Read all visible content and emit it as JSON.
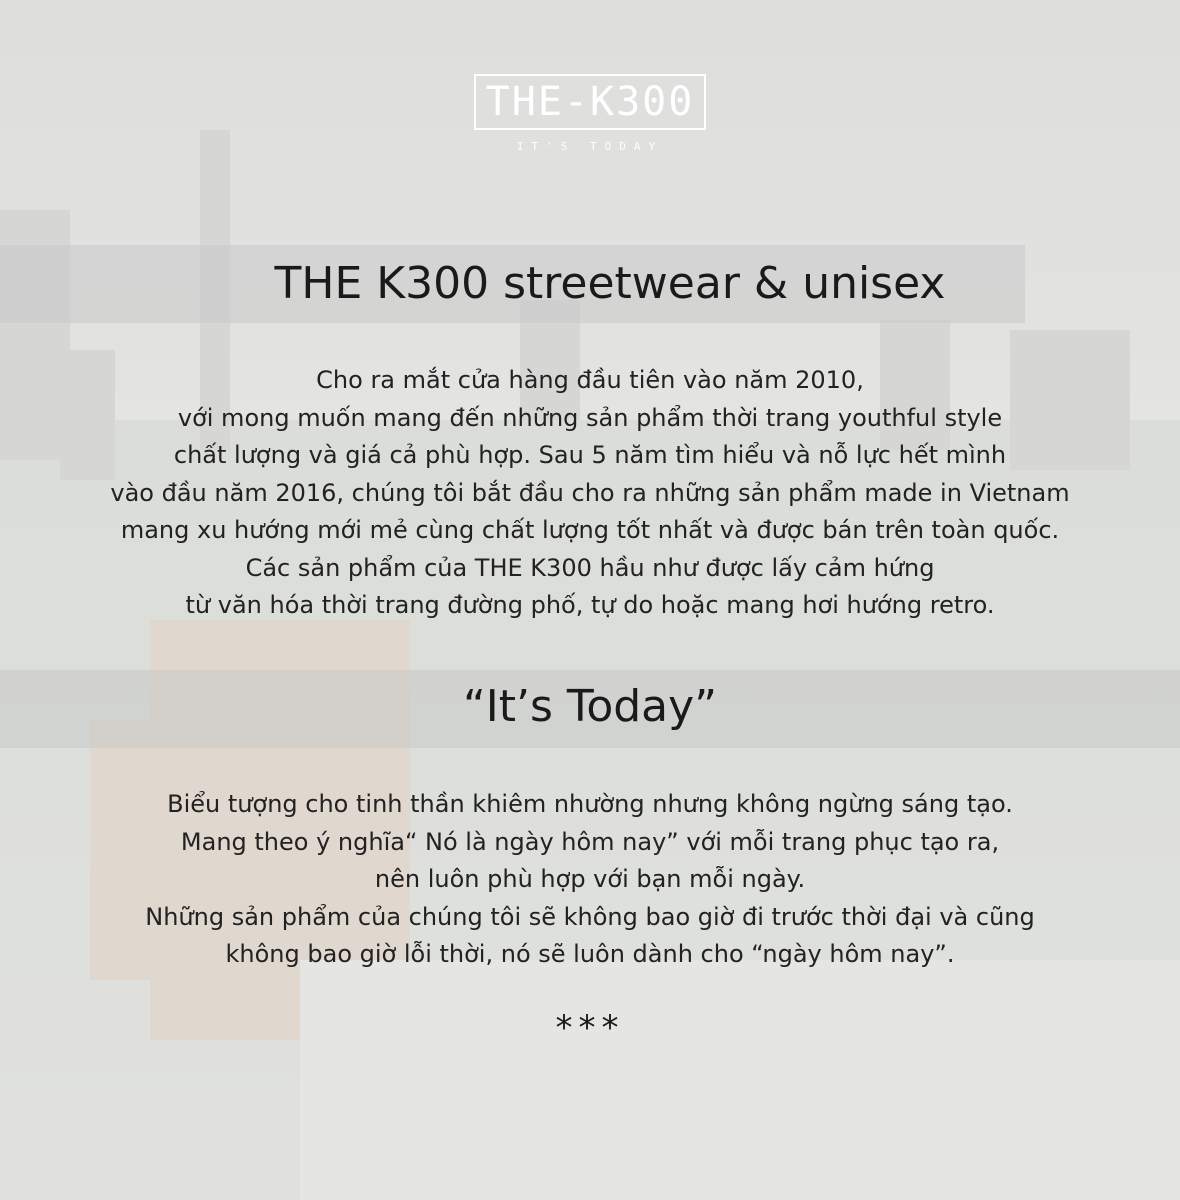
{
  "logo": {
    "wordmark": "THE-K300",
    "tagline": "IT'S TODAY"
  },
  "heading": "THE K300 streetwear & unisex",
  "intro_lines": [
    "Cho ra mắt cửa hàng đầu tiên vào năm 2010,",
    "với mong muốn mang đến những sản phẩm thời trang youthful style",
    "chất lượng và giá cả phù hợp. Sau 5 năm tìm hiểu và nỗ lực hết mình",
    "vào đầu năm 2016, chúng tôi bắt đầu cho ra những sản phẩm made in Vietnam",
    "mang xu hướng mới mẻ cùng chất lượng tốt nhất và được bán trên toàn quốc.",
    "Các sản phẩm của THE K300 hầu như được lấy cảm hứng",
    "từ văn hóa thời trang đường phố, tự do hoặc mang hơi hướng retro."
  ],
  "slogan": "“It’s Today”",
  "slogan_lines": [
    "Biểu tượng cho tinh thần khiêm nhường nhưng không ngừng sáng tạo.",
    "Mang theo ý nghĩa“ Nó là ngày hôm nay” với mỗi trang phục tạo ra,",
    "nên luôn phù hợp với bạn mỗi ngày.",
    "Những sản phẩm của chúng tôi sẽ không bao giờ đi trước thời đại và cũng",
    "không bao giờ lỗi thời, nó sẽ luôn dành cho “ngày hôm nay”."
  ],
  "divider": "***"
}
